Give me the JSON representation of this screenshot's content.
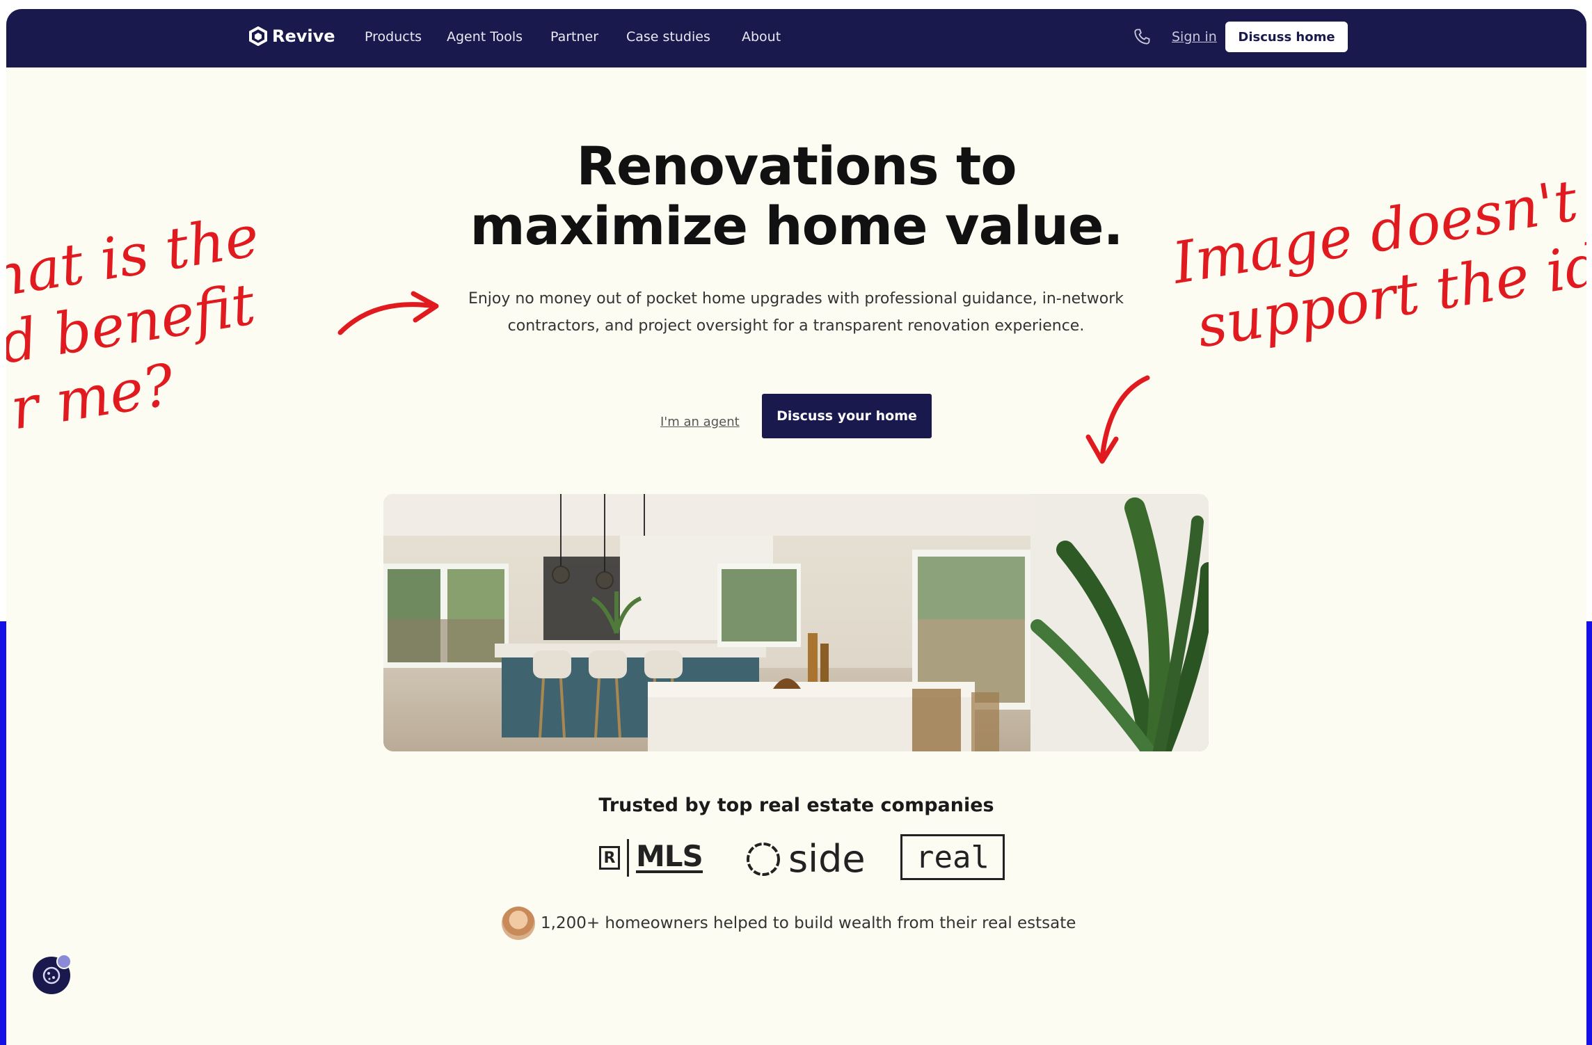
{
  "nav": {
    "brand": "Revive",
    "links": [
      "Products",
      "Agent Tools",
      "Partner",
      "Case studies",
      "About"
    ],
    "sign_in": "Sign in",
    "cta": "Discuss home"
  },
  "hero": {
    "title_line1": "Renovations to",
    "title_line2": "maximize home value.",
    "lead": "Enjoy no money out of pocket home upgrades with professional guidance, in-network contractors, and project oversight for a transparent renovation experience.",
    "agent_link": "I'm an agent",
    "cta": "Discuss your home"
  },
  "trust": {
    "heading": "Trusted by top real estate companies",
    "logos": [
      "MLS",
      "side",
      "real"
    ],
    "social_proof": "1,200+ homeowners helped to build wealth from their real estsate"
  },
  "annotations": {
    "left_lines": [
      "hat is the",
      "d benefit",
      "r me?"
    ],
    "right_lines": [
      "Image doesn't",
      "support the id"
    ]
  },
  "colors": {
    "nav_bg": "#19194d",
    "page_bg": "#fdfcf2",
    "annotation": "#e01a1e",
    "backdrop_blue": "#1410e6"
  }
}
